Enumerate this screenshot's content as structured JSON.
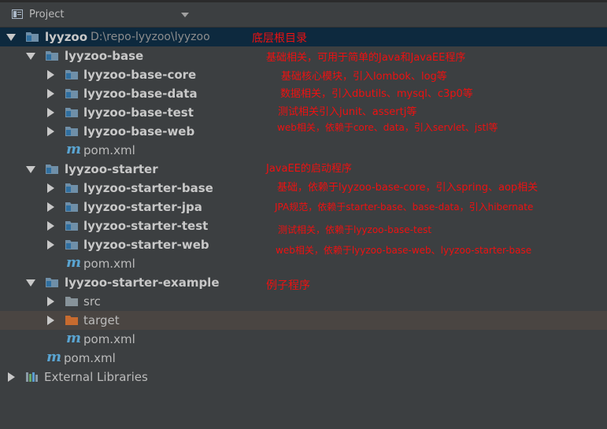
{
  "header": {
    "title": "Project",
    "icon": "project-view-icon"
  },
  "tree": {
    "root": {
      "name": "lyyzoo",
      "path": "D:\\repo-lyyzoo\\lyyzoo"
    },
    "base": {
      "name": "lyyzoo-base",
      "children": [
        "lyyzoo-base-core",
        "lyyzoo-base-data",
        "lyyzoo-base-test",
        "lyyzoo-base-web"
      ],
      "pom": "pom.xml"
    },
    "starter": {
      "name": "lyyzoo-starter",
      "children": [
        "lyyzoo-starter-base",
        "lyyzoo-starter-jpa",
        "lyyzoo-starter-test",
        "lyyzoo-starter-web"
      ],
      "pom": "pom.xml"
    },
    "example": {
      "name": "lyyzoo-starter-example",
      "src": "src",
      "target": "target",
      "pom": "pom.xml"
    },
    "root_pom": "pom.xml",
    "external": "External Libraries"
  },
  "annotations": {
    "root": "底层根目录",
    "base": "基础相关，可用于简单的Java和JavaEE程序",
    "base_core": "基础核心模块，引入lombok、log等",
    "base_data": "数据相关，引入dbutils、mysql、c3p0等",
    "base_test": "测试相关引入junit、assertj等",
    "base_web": "web相关，依赖于core、data，引入servlet、jstl等",
    "starter": "JavaEE的启动程序",
    "starter_base": "基础，依赖于lyyzoo-base-core，引入spring、aop相关",
    "starter_jpa": "JPA规范，依赖于starter-base、base-data，引入hibernate",
    "starter_test": "测试相关，依赖于lyyzoo-base-test",
    "starter_web": "web相关，依赖于lyyzoo-base-web、lyyzoo-starter-base",
    "example": "例子程序"
  },
  "colors": {
    "background": "#3c3f41",
    "selected_row": "#0d293e",
    "highlight_row": "#4a4542",
    "annotation": "#ee1111",
    "module_folder": "#6f8fa8",
    "target_folder": "#c86b2f",
    "maven": "#5aa5d2"
  }
}
